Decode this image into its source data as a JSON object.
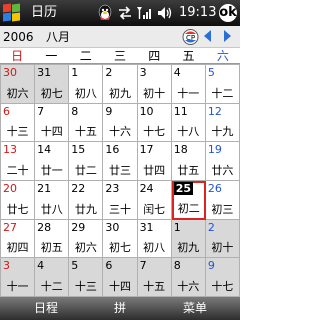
{
  "statusbar": {
    "app_title": "日历",
    "time": "19:13",
    "ok_label": "ok",
    "icons": [
      "windows-start-icon",
      "qq-icon",
      "connectivity-icon",
      "signal-icon",
      "volume-icon"
    ]
  },
  "navbar": {
    "year": "2006",
    "month": "八月",
    "icons": [
      "cpy-icon",
      "prev-month-icon",
      "next-month-icon"
    ]
  },
  "weekdays": [
    "日",
    "一",
    "二",
    "三",
    "四",
    "五",
    "六"
  ],
  "weekday_colors": {
    "sunday": "#d01818",
    "saturday": "#2255d0"
  },
  "calendar": [
    {
      "day": "30",
      "lunar": "初六",
      "other": true
    },
    {
      "day": "31",
      "lunar": "初七",
      "other": true
    },
    {
      "day": "1",
      "lunar": "初八",
      "other": false
    },
    {
      "day": "2",
      "lunar": "初九",
      "other": false
    },
    {
      "day": "3",
      "lunar": "初十",
      "other": false
    },
    {
      "day": "4",
      "lunar": "十一",
      "other": false
    },
    {
      "day": "5",
      "lunar": "十二",
      "other": false
    },
    {
      "day": "6",
      "lunar": "十三",
      "other": false
    },
    {
      "day": "7",
      "lunar": "十四",
      "other": false
    },
    {
      "day": "8",
      "lunar": "十五",
      "other": false
    },
    {
      "day": "9",
      "lunar": "十六",
      "other": false
    },
    {
      "day": "10",
      "lunar": "十七",
      "other": false
    },
    {
      "day": "11",
      "lunar": "十八",
      "other": false
    },
    {
      "day": "12",
      "lunar": "十九",
      "other": false
    },
    {
      "day": "13",
      "lunar": "二十",
      "other": false
    },
    {
      "day": "14",
      "lunar": "廿一",
      "other": false
    },
    {
      "day": "15",
      "lunar": "廿二",
      "other": false
    },
    {
      "day": "16",
      "lunar": "廿三",
      "other": false
    },
    {
      "day": "17",
      "lunar": "廿四",
      "other": false
    },
    {
      "day": "18",
      "lunar": "廿五",
      "other": false
    },
    {
      "day": "19",
      "lunar": "廿六",
      "other": false
    },
    {
      "day": "20",
      "lunar": "廿七",
      "other": false
    },
    {
      "day": "21",
      "lunar": "廿八",
      "other": false
    },
    {
      "day": "22",
      "lunar": "廿九",
      "other": false
    },
    {
      "day": "23",
      "lunar": "三十",
      "other": false
    },
    {
      "day": "24",
      "lunar": "闰七",
      "other": false
    },
    {
      "day": "25",
      "lunar": "初二",
      "other": false,
      "today": true
    },
    {
      "day": "26",
      "lunar": "初三",
      "other": false
    },
    {
      "day": "27",
      "lunar": "初四",
      "other": false
    },
    {
      "day": "28",
      "lunar": "初五",
      "other": false
    },
    {
      "day": "29",
      "lunar": "初六",
      "other": false
    },
    {
      "day": "30",
      "lunar": "初七",
      "other": false
    },
    {
      "day": "31",
      "lunar": "初八",
      "other": false
    },
    {
      "day": "1",
      "lunar": "初九",
      "other": true
    },
    {
      "day": "2",
      "lunar": "初十",
      "other": true
    },
    {
      "day": "3",
      "lunar": "十一",
      "other": true
    },
    {
      "day": "4",
      "lunar": "十二",
      "other": true
    },
    {
      "day": "5",
      "lunar": "十三",
      "other": true
    },
    {
      "day": "6",
      "lunar": "十四",
      "other": true
    },
    {
      "day": "7",
      "lunar": "十五",
      "other": true
    },
    {
      "day": "8",
      "lunar": "十六",
      "other": true
    },
    {
      "day": "9",
      "lunar": "十七",
      "other": true
    }
  ],
  "bottombar": {
    "left": "日程",
    "center": "拼",
    "right": "菜单"
  }
}
